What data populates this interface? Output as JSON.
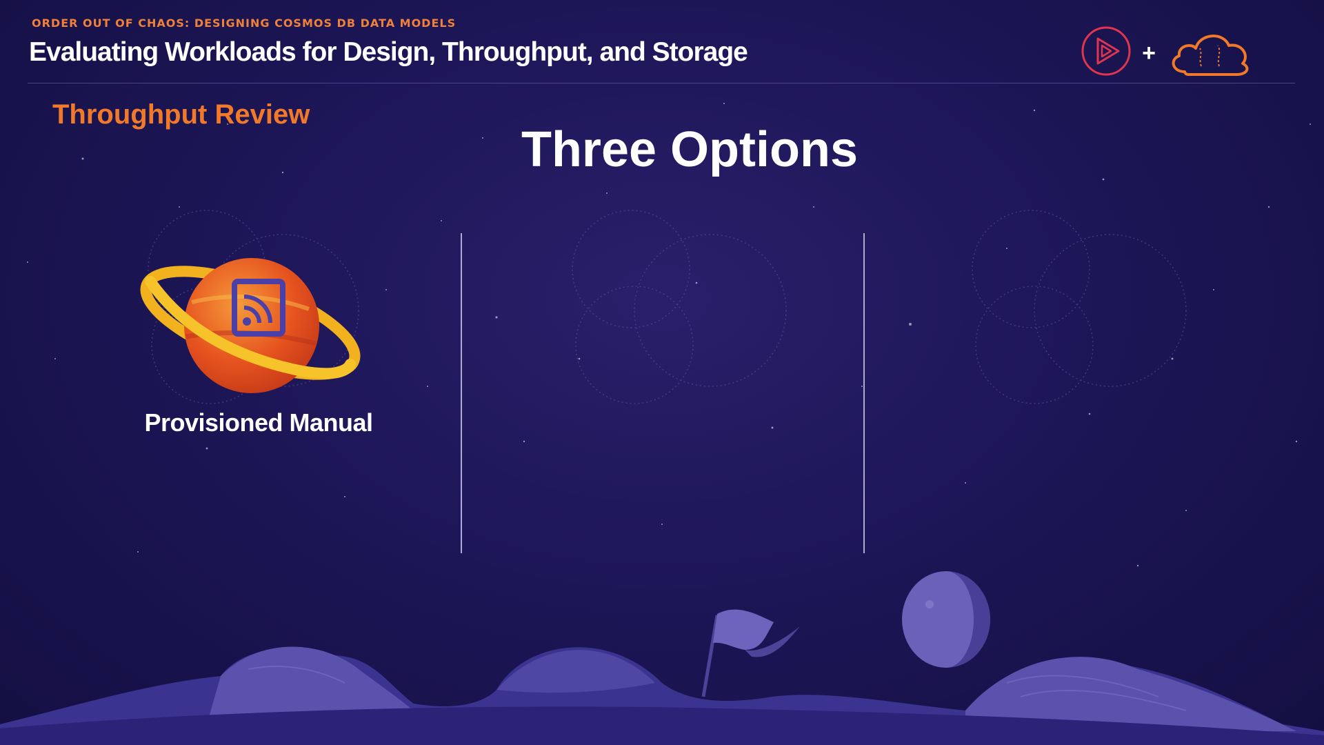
{
  "header": {
    "course_title": "ORDER OUT OF CHAOS: DESIGNING COSMOS DB DATA MODELS",
    "module_title": "Evaluating Workloads for Design, Throughput, and Storage",
    "logo_separator": "+"
  },
  "slide": {
    "section_label": "Throughput Review",
    "title": "Three Options",
    "options": [
      {
        "label": "Provisioned Manual",
        "icon": "rss-planet-icon"
      },
      {
        "label": "",
        "icon": "decorative-circles"
      },
      {
        "label": "",
        "icon": "decorative-circles"
      }
    ]
  },
  "colors": {
    "background": "#1d1657",
    "accent_orange": "#f07a2a",
    "logo_red": "#e0344f",
    "text_white": "#ffffff"
  }
}
